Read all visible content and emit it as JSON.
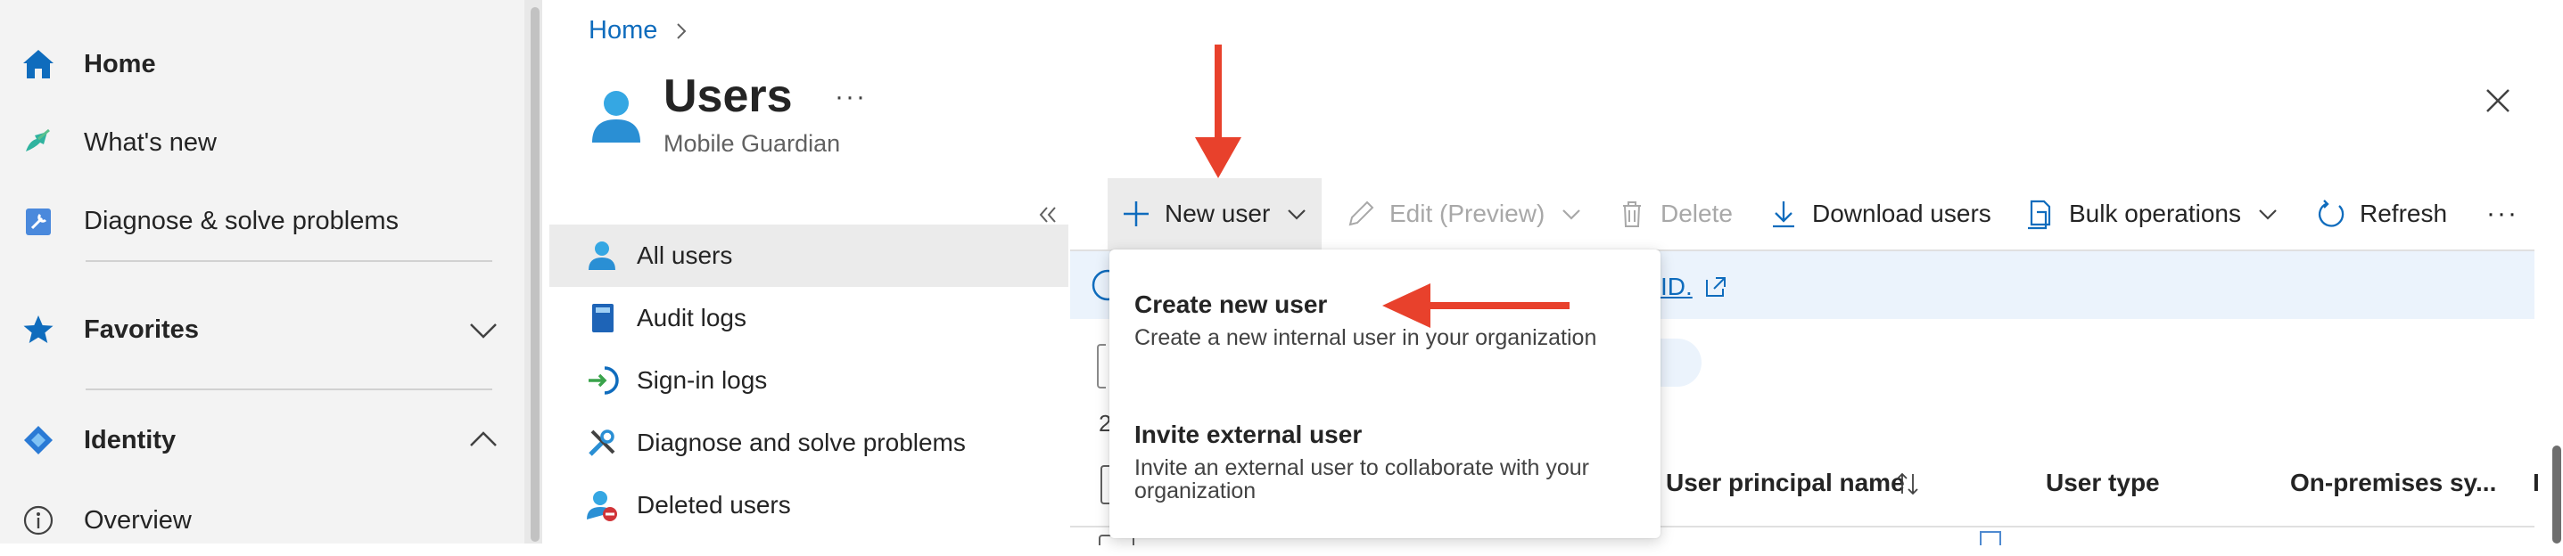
{
  "leftnav": {
    "home": "Home",
    "whats_new": "What's new",
    "diagnose": "Diagnose & solve problems",
    "favorites": "Favorites",
    "identity": "Identity",
    "overview": "Overview"
  },
  "breadcrumb": {
    "home": "Home"
  },
  "page": {
    "title": "Users",
    "subtitle": "Mobile Guardian",
    "more": "···"
  },
  "blade_menu": [
    {
      "label": "All users",
      "icon": "user-icon",
      "active": true
    },
    {
      "label": "Audit logs",
      "icon": "book-icon",
      "active": false
    },
    {
      "label": "Sign-in logs",
      "icon": "sign-in-icon",
      "active": false
    },
    {
      "label": "Diagnose and solve problems",
      "icon": "wrench-icon",
      "active": false
    },
    {
      "label": "Deleted users",
      "icon": "deleted-user-icon",
      "active": false
    }
  ],
  "commands": {
    "new_user": "New user",
    "edit": "Edit (Preview)",
    "delete": "Delete",
    "download": "Download users",
    "bulk": "Bulk operations",
    "refresh": "Refresh",
    "more": "···"
  },
  "banner": {
    "link_fragment": "ID."
  },
  "filter": {
    "pill_fragment": "er"
  },
  "list": {
    "count_fragment": "2"
  },
  "table": {
    "headers": [
      "User principal name",
      "User type",
      "On-premises sy...",
      "I"
    ]
  },
  "dropdown": {
    "items": [
      {
        "title": "Create new user",
        "description": "Create a new internal user in your organization"
      },
      {
        "title": "Invite external user",
        "description": "Invite an external user to collaborate with your organization"
      }
    ]
  },
  "colors": {
    "accent": "#0f6cbd",
    "annotation": "#e8412c",
    "nav_bg": "#f3f3f3",
    "banner_bg": "#ebf3fc"
  }
}
